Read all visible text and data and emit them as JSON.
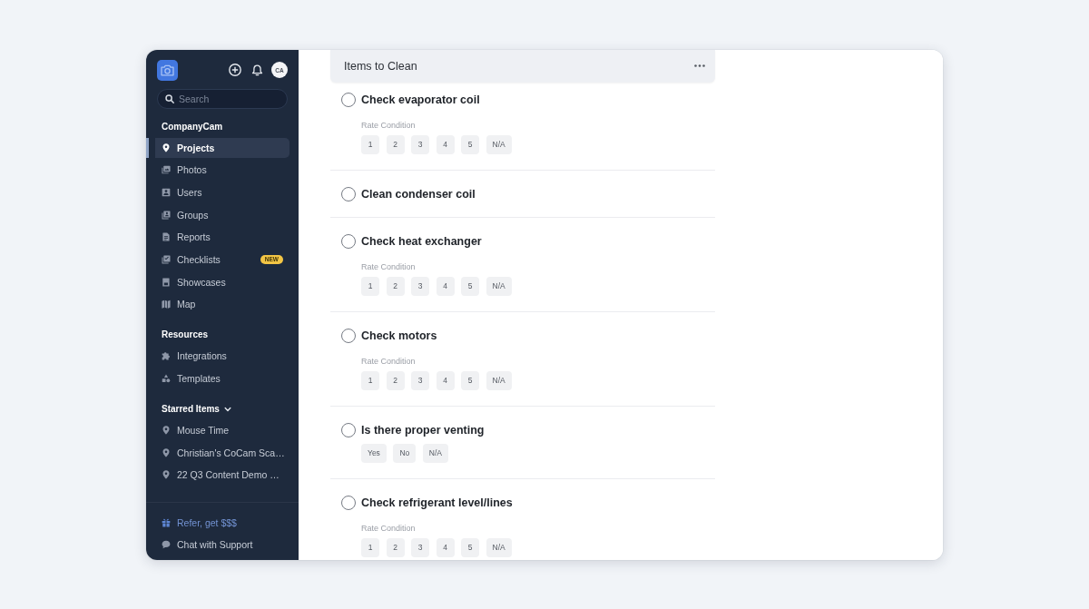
{
  "sidebar": {
    "avatar": "CA",
    "search": {
      "placeholder": "Search"
    },
    "sections": [
      {
        "heading": "CompanyCam",
        "items": [
          {
            "label": "Projects",
            "selected": true
          },
          {
            "label": "Photos",
            "selected": false
          },
          {
            "label": "Users",
            "selected": false
          },
          {
            "label": "Groups",
            "selected": false
          },
          {
            "label": "Reports",
            "selected": false
          },
          {
            "label": "Checklists",
            "selected": false,
            "badge": "NEW"
          },
          {
            "label": "Showcases",
            "selected": false
          },
          {
            "label": "Map",
            "selected": false
          }
        ]
      },
      {
        "heading": "Resources",
        "items": [
          {
            "label": "Integrations",
            "selected": false
          },
          {
            "label": "Templates",
            "selected": false
          }
        ]
      },
      {
        "heading": "Starred Items",
        "expanded": true,
        "items": [
          {
            "label": "Mouse Time",
            "selected": false
          },
          {
            "label": "Christian's CoCam Sca…",
            "selected": false
          },
          {
            "label": "22 Q3 Content Demo …",
            "selected": false
          }
        ]
      }
    ],
    "footer": [
      {
        "label": "Refer, get $$$",
        "kind": "promo"
      },
      {
        "label": "Chat with Support",
        "kind": "link"
      }
    ]
  },
  "checklist": {
    "title": "Items to Clean",
    "items": [
      {
        "title": "Check evaporator coil",
        "checked": false,
        "kind": "rating",
        "label": "Rate Condition",
        "options": [
          {
            "label": "1",
            "selected": false
          },
          {
            "label": "2",
            "selected": false
          },
          {
            "label": "3",
            "selected": false
          },
          {
            "label": "4",
            "selected": false
          },
          {
            "label": "5",
            "selected": false
          },
          {
            "label": "N/A",
            "selected": false
          }
        ]
      },
      {
        "title": "Clean condenser coil",
        "checked": false,
        "kind": "task"
      },
      {
        "title": "Check heat exchanger",
        "checked": false,
        "kind": "rating",
        "label": "Rate Condition",
        "options": [
          {
            "label": "1",
            "selected": false
          },
          {
            "label": "2",
            "selected": false
          },
          {
            "label": "3",
            "selected": false
          },
          {
            "label": "4",
            "selected": false
          },
          {
            "label": "5",
            "selected": false
          },
          {
            "label": "N/A",
            "selected": false
          }
        ]
      },
      {
        "title": "Check motors",
        "checked": false,
        "kind": "rating",
        "label": "Rate Condition",
        "options": [
          {
            "label": "1",
            "selected": false
          },
          {
            "label": "2",
            "selected": false
          },
          {
            "label": "3",
            "selected": false
          },
          {
            "label": "4",
            "selected": false
          },
          {
            "label": "5",
            "selected": false
          },
          {
            "label": "N/A",
            "selected": false
          }
        ]
      },
      {
        "title": "Is there proper venting",
        "checked": false,
        "kind": "choice",
        "options": [
          {
            "label": "Yes",
            "selected": false
          },
          {
            "label": "No",
            "selected": false
          },
          {
            "label": "N/A",
            "selected": false
          }
        ]
      },
      {
        "title": "Check refrigerant level/lines",
        "checked": false,
        "kind": "rating",
        "label": "Rate Condition",
        "options": [
          {
            "label": "1",
            "selected": false
          },
          {
            "label": "2",
            "selected": false
          },
          {
            "label": "3",
            "selected": false
          },
          {
            "label": "4",
            "selected": false
          },
          {
            "label": "5",
            "selected": false
          },
          {
            "label": "N/A",
            "selected": false
          }
        ]
      }
    ]
  }
}
